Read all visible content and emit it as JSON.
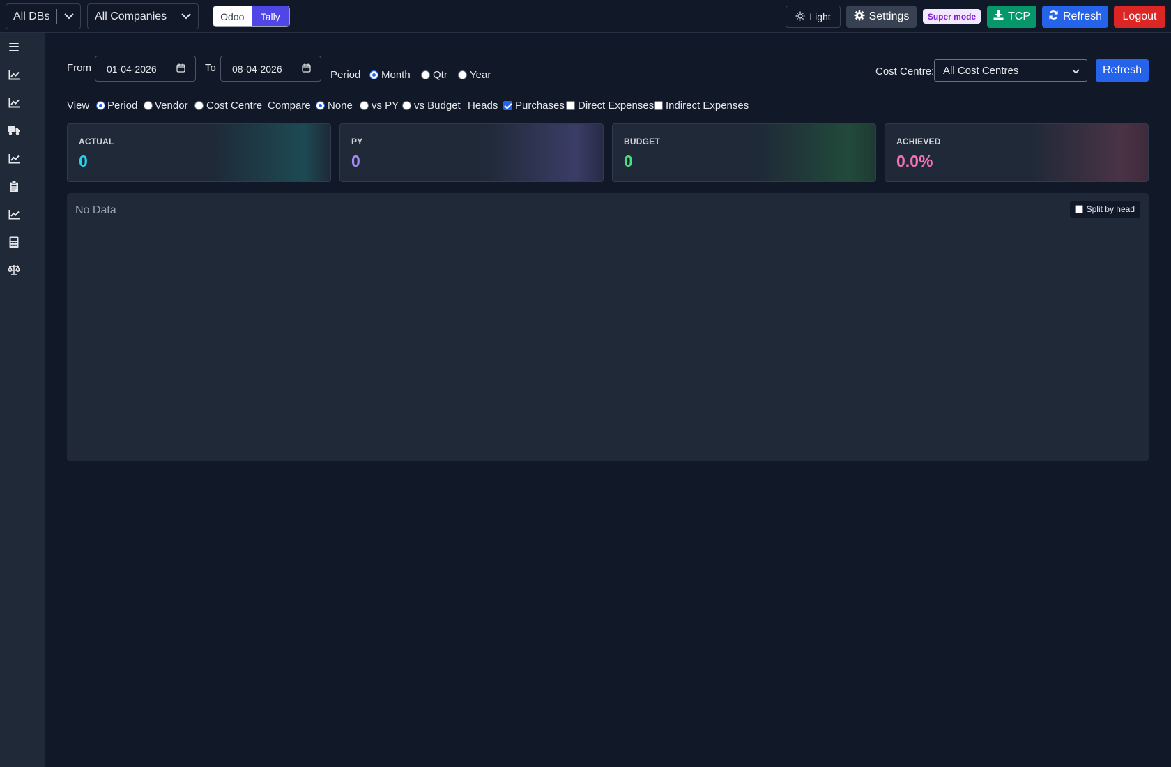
{
  "topbar": {
    "db_select": "All DBs",
    "company_select": "All Companies",
    "source_toggle": {
      "odoo": "Odoo",
      "tally": "Tally"
    },
    "light_label": "Light",
    "settings_label": "Settings",
    "super_mode_label": "Super mode",
    "tcp_label": "TCP",
    "refresh_label": "Refresh",
    "logout_label": "Logout"
  },
  "sidebar": {
    "icons": [
      "menu-icon",
      "chart-line-icon",
      "chart-line-icon",
      "truck-icon",
      "chart-line-icon",
      "clipboard-icon",
      "chart-line-icon",
      "calculator-icon",
      "scale-icon"
    ]
  },
  "filters": {
    "from_label": "From",
    "from_value": "01-04-2026",
    "to_label": "To",
    "to_value": "08-04-2026",
    "period_label": "Period",
    "period_options": [
      "Month",
      "Qtr",
      "Year"
    ],
    "period_selected": "Month",
    "cost_centre_label": "Cost Centre:",
    "cost_centre_value": "All Cost Centres",
    "refresh_label": "Refresh",
    "view_label": "View",
    "view_options": [
      "Period",
      "Vendor",
      "Cost Centre"
    ],
    "view_selected": "Period",
    "compare_label": "Compare",
    "compare_options": [
      "None",
      "vs PY",
      "vs Budget"
    ],
    "compare_selected": "None",
    "heads_label": "Heads",
    "heads_options": [
      "Purchases",
      "Direct Expenses",
      "Indirect Expenses"
    ],
    "heads_checked": [
      "Purchases"
    ]
  },
  "cards": [
    {
      "title": "ACTUAL",
      "value": "0",
      "color": "#22d3ee"
    },
    {
      "title": "PY",
      "value": "0",
      "color": "#a78bfa"
    },
    {
      "title": "BUDGET",
      "value": "0",
      "color": "#4ade80"
    },
    {
      "title": "ACHIEVED",
      "value": "0.0%",
      "color": "#f472b6"
    }
  ],
  "panel": {
    "empty_text": "No Data",
    "split_label": "Split by head"
  }
}
